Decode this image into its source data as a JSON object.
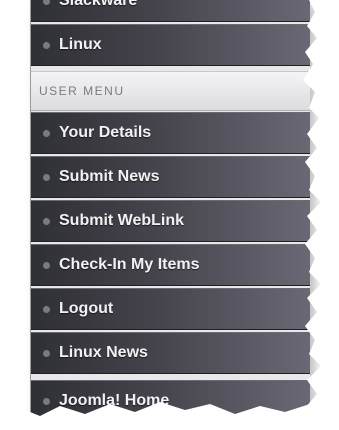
{
  "menu": {
    "top_partial_label": "Slackware",
    "first_item": "Linux",
    "section_title": "USER MENU",
    "items": [
      {
        "label": "Your Details"
      },
      {
        "label": "Submit News"
      },
      {
        "label": "Submit WebLink"
      },
      {
        "label": "Check-In My Items"
      },
      {
        "label": "Logout"
      },
      {
        "label": "Linux News"
      },
      {
        "label": "Joomla! Home"
      }
    ]
  },
  "colors": {
    "item_bg_dark": "#2f2f36",
    "item_bg_light": "#6a6874",
    "header_text": "#7a7a80",
    "item_text": "#f2f2f4"
  }
}
